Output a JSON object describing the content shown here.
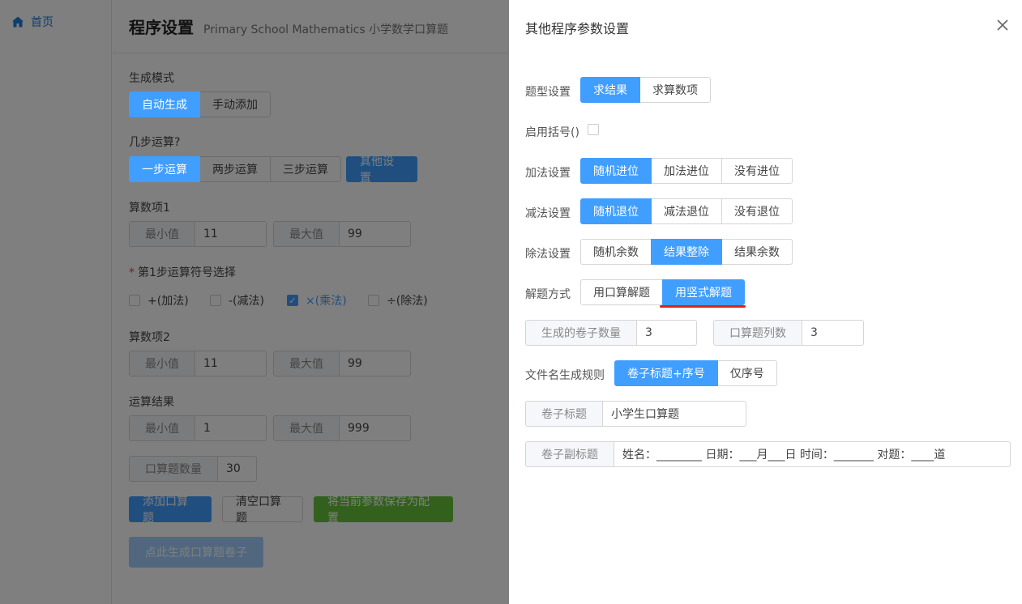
{
  "nav": {
    "home_label": "首页",
    "home_icon": "home-icon"
  },
  "header": {
    "title": "程序设置",
    "subtitle": "Primary School Mathematics 小学数学口算题"
  },
  "mode": {
    "label": "生成模式",
    "options": [
      "自动生成",
      "手动添加"
    ],
    "selected": "自动生成"
  },
  "steps": {
    "label": "几步运算?",
    "options": [
      "一步运算",
      "两步运算",
      "三步运算"
    ],
    "selected": "一步运算",
    "other_button": "其他设置"
  },
  "operand1": {
    "label": "算数项1",
    "min_label": "最小值",
    "min_value": "11",
    "max_label": "最大值",
    "max_value": "99"
  },
  "operator": {
    "required_mark": "*",
    "label": "第1步运算符号选择",
    "options": [
      {
        "label": "+(加法)",
        "checked": false
      },
      {
        "label": "-(减法)",
        "checked": false
      },
      {
        "label": "×(乘法)",
        "checked": true
      },
      {
        "label": "÷(除法)",
        "checked": false
      }
    ]
  },
  "operand2": {
    "label": "算数项2",
    "min_label": "最小值",
    "min_value": "11",
    "max_label": "最大值",
    "max_value": "99"
  },
  "result": {
    "label": "运算结果",
    "min_label": "最小值",
    "min_value": "1",
    "max_label": "最大值",
    "max_value": "999"
  },
  "count": {
    "label": "口算题数量",
    "value": "30"
  },
  "actions": {
    "add": "添加口算题",
    "clear": "清空口算题",
    "save": "将当前参数保存为配置",
    "generate": "点此生成口算题卷子"
  },
  "drawer": {
    "title": "其他程序参数设置",
    "close_icon": "close-icon",
    "question_type": {
      "label": "题型设置",
      "options": [
        "求结果",
        "求算数项"
      ],
      "selected": "求结果"
    },
    "brackets": {
      "label": "启用括号()",
      "checked": false
    },
    "addition": {
      "label": "加法设置",
      "options": [
        "随机进位",
        "加法进位",
        "没有进位"
      ],
      "selected": "随机进位"
    },
    "subtraction": {
      "label": "减法设置",
      "options": [
        "随机退位",
        "减法退位",
        "没有退位"
      ],
      "selected": "随机退位"
    },
    "division": {
      "label": "除法设置",
      "options": [
        "随机余数",
        "结果整除",
        "结果余数"
      ],
      "selected": "结果整除"
    },
    "solve_method": {
      "label": "解题方式",
      "options": [
        "用口算解题",
        "用竖式解题"
      ],
      "selected": "用竖式解题"
    },
    "paper_count": {
      "label": "生成的卷子数量",
      "value": "3"
    },
    "columns": {
      "label": "口算题列数",
      "value": "3"
    },
    "filename_rule": {
      "label": "文件名生成规则",
      "options": [
        "卷子标题+序号",
        "仅序号"
      ],
      "selected": "卷子标题+序号"
    },
    "paper_title": {
      "label": "卷子标题",
      "value": "小学生口算题"
    },
    "paper_subtitle": {
      "label": "卷子副标题",
      "value": "姓名：________ 日期：___月___日 时间：_______ 对题：____道"
    }
  },
  "colors": {
    "primary": "#409eff",
    "success": "#67c23a",
    "highlight_underline": "#e0201a"
  }
}
